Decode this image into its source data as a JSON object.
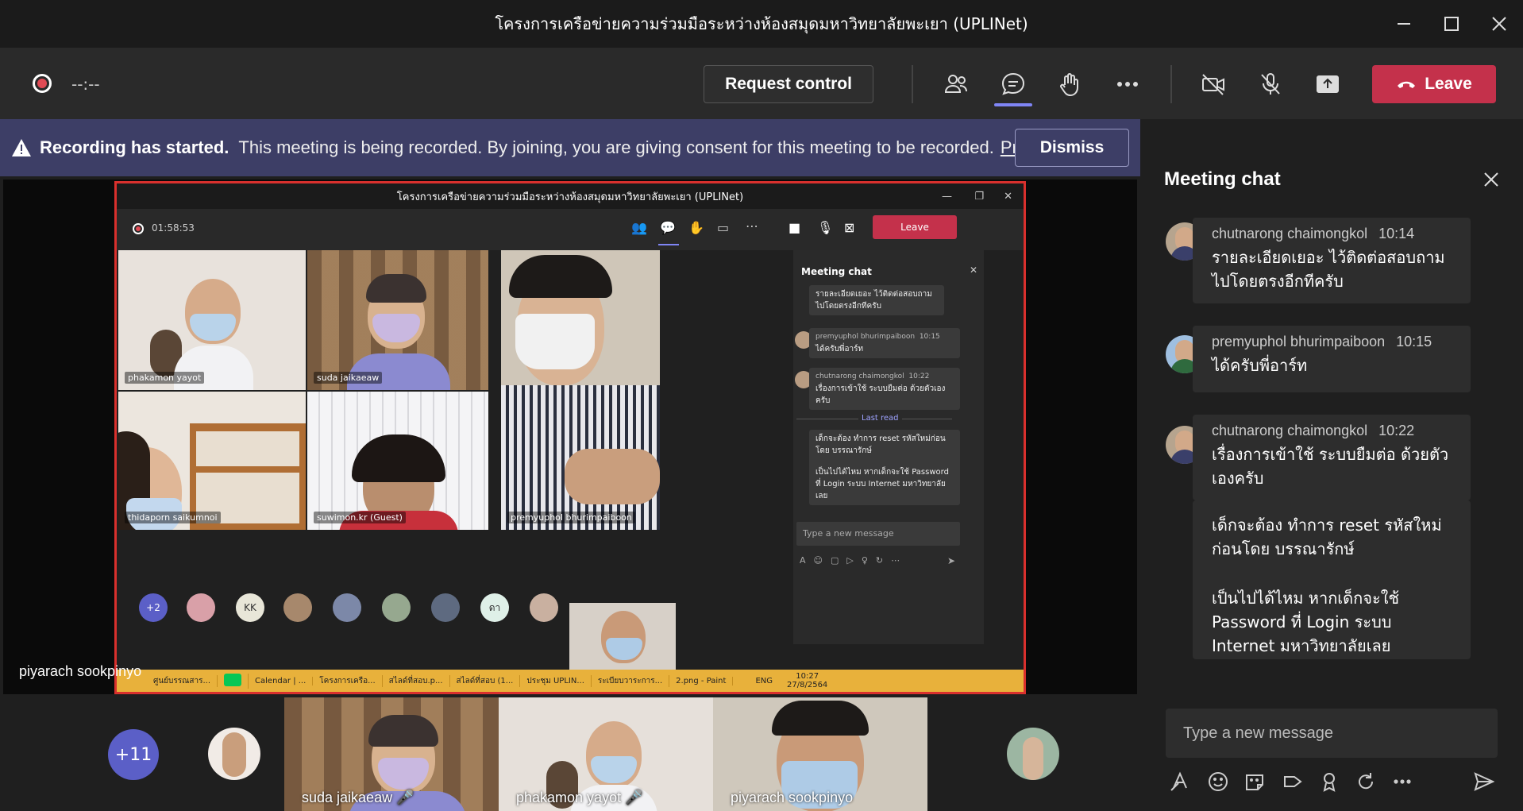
{
  "window": {
    "title": "โครงการเครือข่ายความร่วมมือระหว่างห้องสมุดมหาวิทยาลัยพะเยา (UPLINet)"
  },
  "toolbar": {
    "recording_time": "--:--",
    "request_control_label": "Request control",
    "leave_label": "Leave"
  },
  "banner": {
    "heading": "Recording has started.",
    "message": "This meeting is being recorded. By joining, you are giving consent for this meeting to be recorded.",
    "link": "Priv...",
    "dismiss_label": "Dismiss"
  },
  "shared_screen": {
    "title": "โครงการเครือข่ายความร่วมมือระหว่างห้องสมุดมหาวิทยาลัยพะเยา (UPLINet)",
    "timer": "01:58:53",
    "leave_label": "Leave",
    "tiles": [
      {
        "name": "phakamon yayot"
      },
      {
        "name": "suda jaikaeaw"
      },
      {
        "name": "premyuphol bhurimpaiboon"
      },
      {
        "name": "thidaporn saikumnoi"
      },
      {
        "name": "suwimon.kr (Guest)"
      }
    ],
    "avatars": [
      "+2",
      "KK",
      "ดา"
    ],
    "chat": {
      "title": "Meeting chat",
      "msg1": "รายละเอียดเยอะ ไว้ติดต่อสอบถามไปโดยตรงอีกทีครับ",
      "msg2_name": "premyuphol bhurimpaiboon",
      "msg2_time": "10:15",
      "msg2_text": "ได้ครับพี่อาร์ท",
      "msg3_name": "chutnarong chaimongkol",
      "msg3_time": "10:22",
      "msg3_text": "เรื่องการเข้าใช้ ระบบยืมต่อ ด้วยตัวเองครับ",
      "last_read": "Last read",
      "msg4_text": "เด็กจะต้อง ทำการ reset รหัสใหม่ก่อนโดย บรรณารักษ์",
      "msg5_text": "เป็นไปได้ไหม หากเด็กจะใช้ Password ที่ Login ระบบ Internet มหาวิทยาลัยเลย",
      "composer_placeholder": "Type a new message"
    },
    "taskbar": {
      "items": [
        "ศูนย์บรรณสาร...",
        "",
        "Calendar | ...",
        "โครงการเครือ...",
        "สไลด์ที่สอบ.p...",
        "สไลด์ที่สอบ (1...",
        "ประชุม UPLIN...",
        "ระเบียบวาระการ...",
        "2.png - Paint"
      ],
      "lang": "ENG",
      "time": "10:27",
      "date": "27/8/2564"
    }
  },
  "presenter_name": "piyarach sookpinyo",
  "gallery": {
    "overflow_count": "+11",
    "tiles": [
      {
        "name": "suda jaikaeaw"
      },
      {
        "name": "phakamon yayot"
      },
      {
        "name": "piyarach sookpinyo"
      }
    ]
  },
  "chat": {
    "title": "Meeting chat",
    "messages": [
      {
        "author": "chutnarong chaimongkol",
        "time": "10:14",
        "text": "รายละเอียดเยอะ ไว้ติดต่อสอบถามไปโดยตรงอีกทีครับ"
      },
      {
        "author": "premyuphol bhurimpaiboon",
        "time": "10:15",
        "text": "ได้ครับพี่อาร์ท"
      },
      {
        "author": "chutnarong chaimongkol",
        "time": "10:22",
        "text": "เรื่องการเข้าใช้ ระบบยืมต่อ ด้วยตัวเองครับ"
      }
    ],
    "followup": {
      "text1": "เด็กจะต้อง ทำการ reset รหัสใหม่ก่อนโดย บรรณารักษ์",
      "text2": "เป็นไปได้ไหม หากเด็กจะใช้ Password ที่ Login ระบบ Internet มหาวิทยาลัยเลย"
    },
    "composer_placeholder": "Type a new message"
  },
  "colors": {
    "accent": "#5b5fc7",
    "leave": "#c4314b",
    "banner": "#3d3e66",
    "recording": "#e04b55"
  }
}
